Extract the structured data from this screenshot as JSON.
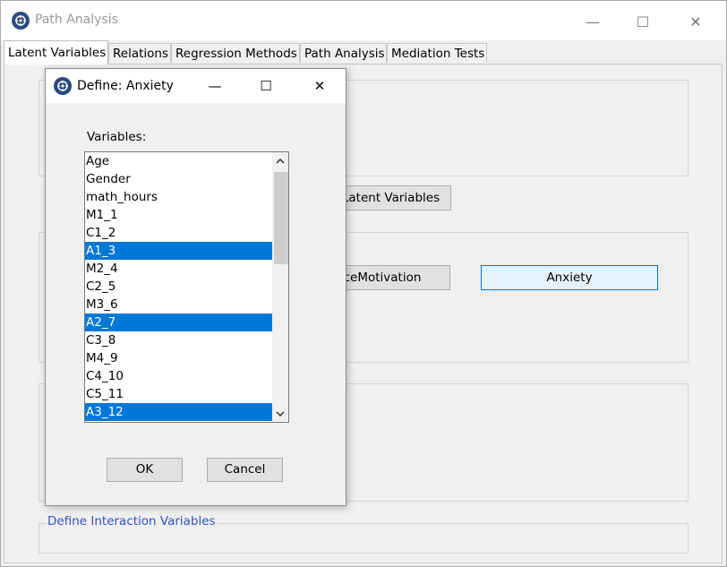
{
  "main_window": {
    "title": "Path Analysis",
    "controls": {
      "minimize": "—",
      "maximize": "☐",
      "close": "✕"
    },
    "tabs": [
      {
        "label": "Latent Variables",
        "active": true
      },
      {
        "label": "Relations"
      },
      {
        "label": "Regression Methods"
      },
      {
        "label": "Path Analysis"
      },
      {
        "label": "Mediation Tests"
      }
    ],
    "latent_variables_button": "Latent Variables",
    "latent_buttons": [
      {
        "label": "ceMotivation"
      },
      {
        "label": "Anxiety"
      }
    ],
    "interaction_group_label": "Define Interaction Variables"
  },
  "dialog": {
    "title": "Define: Anxiety",
    "controls": {
      "minimize": "—",
      "maximize": "☐",
      "close": "✕"
    },
    "variables_label": "Variables:",
    "variables": [
      {
        "name": "Age",
        "selected": false
      },
      {
        "name": "Gender",
        "selected": false
      },
      {
        "name": "math_hours",
        "selected": false
      },
      {
        "name": "M1_1",
        "selected": false
      },
      {
        "name": "C1_2",
        "selected": false
      },
      {
        "name": "A1_3",
        "selected": true
      },
      {
        "name": "M2_4",
        "selected": false
      },
      {
        "name": "C2_5",
        "selected": false
      },
      {
        "name": "M3_6",
        "selected": false
      },
      {
        "name": "A2_7",
        "selected": true
      },
      {
        "name": "C3_8",
        "selected": false
      },
      {
        "name": "M4_9",
        "selected": false
      },
      {
        "name": "C4_10",
        "selected": false
      },
      {
        "name": "C5_11",
        "selected": false
      },
      {
        "name": "A3_12",
        "selected": true
      }
    ],
    "ok_label": "OK",
    "cancel_label": "Cancel"
  },
  "colors": {
    "selection": "#0078d7",
    "group_label": "#2f4fd0",
    "window_bg": "#f0f0f0"
  }
}
